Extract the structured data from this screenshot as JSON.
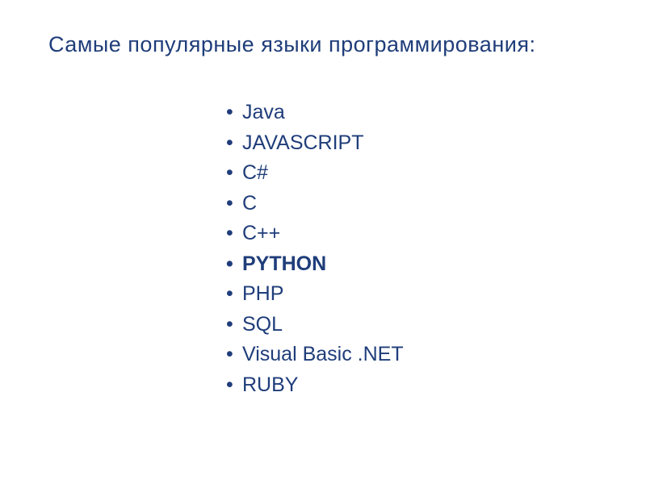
{
  "slide": {
    "title": "Самые популярные языки программирования:",
    "items": [
      {
        "label": "Java",
        "bold": false
      },
      {
        "label": "JAVASCRIPT",
        "bold": false
      },
      {
        "label": "C#",
        "bold": false
      },
      {
        "label": "C",
        "bold": false
      },
      {
        "label": "C++",
        "bold": false
      },
      {
        "label": "PYTHON",
        "bold": true
      },
      {
        "label": "PHP",
        "bold": false
      },
      {
        "label": "SQL",
        "bold": false
      },
      {
        "label": "Visual Basic .NET",
        "bold": false
      },
      {
        "label": "RUBY",
        "bold": false
      }
    ]
  }
}
